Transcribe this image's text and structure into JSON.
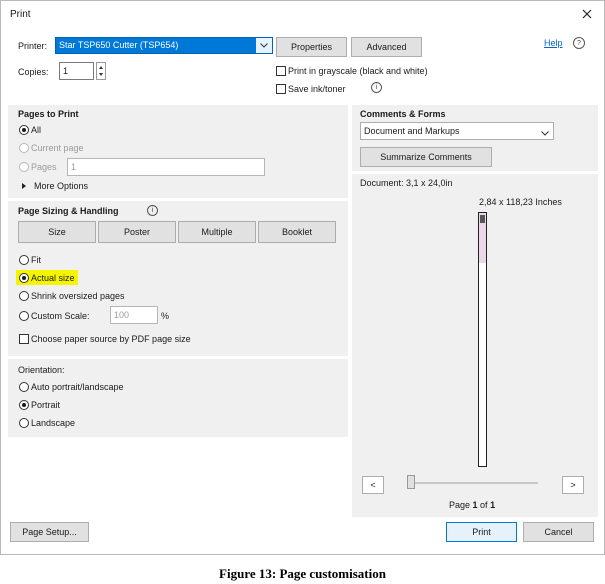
{
  "window": {
    "title": "Print"
  },
  "printer": {
    "label": "Printer:",
    "value": "Star TSP650 Cutter (TSP654)",
    "properties_label": "Properties",
    "advanced_label": "Advanced",
    "help_label": "Help"
  },
  "copies": {
    "label": "Copies:",
    "value": "1"
  },
  "options": {
    "grayscale_label": "Print in grayscale (black and white)",
    "save_ink_label": "Save ink/toner"
  },
  "pages_to_print": {
    "heading": "Pages to Print",
    "all_label": "All",
    "current_label": "Current page",
    "pages_label": "Pages",
    "pages_value": "1",
    "more_options_label": "More Options",
    "selected": "All"
  },
  "sizing": {
    "heading": "Page Sizing & Handling",
    "tabs": [
      "Size",
      "Poster",
      "Multiple",
      "Booklet"
    ],
    "fit_label": "Fit",
    "actual_label": "Actual size",
    "shrink_label": "Shrink oversized pages",
    "custom_label": "Custom Scale:",
    "custom_value": "100",
    "percent": "%",
    "paper_source_label": "Choose paper source by PDF page size",
    "selected": "Actual size",
    "highlight_color": "#f5f500"
  },
  "orientation": {
    "label": "Orientation:",
    "auto_label": "Auto portrait/landscape",
    "portrait_label": "Portrait",
    "landscape_label": "Landscape",
    "selected": "Portrait"
  },
  "comments": {
    "heading": "Comments & Forms",
    "value": "Document and Markups",
    "summarize_label": "Summarize Comments"
  },
  "preview": {
    "document_size": "Document: 3,1 x 24,0in",
    "page_size": "2,84 x 118,23 Inches",
    "prev_label": "<",
    "next_label": ">",
    "page_prefix": "Page ",
    "page_number": "1",
    "page_of": " of ",
    "page_total": "1",
    "accent_color": "#e8d8e8"
  },
  "footer": {
    "page_setup_label": "Page Setup...",
    "print_label": "Print",
    "cancel_label": "Cancel"
  },
  "caption": "Figure 13: Page customisation"
}
